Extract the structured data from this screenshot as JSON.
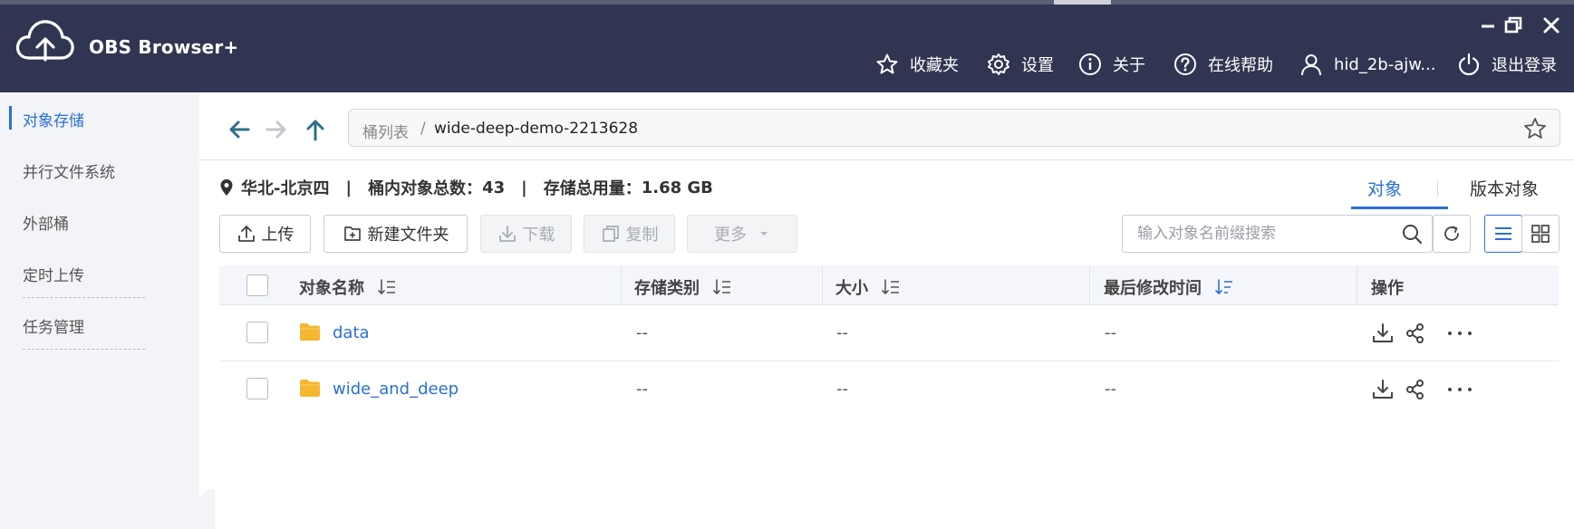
{
  "app": {
    "title": "OBS Browser+"
  },
  "window": {
    "minimize": "minimize",
    "maximize": "restore",
    "close": "close"
  },
  "topnav": [
    {
      "label": "收藏夹",
      "icon": "star-icon"
    },
    {
      "label": "设置",
      "icon": "gear-icon"
    },
    {
      "label": "关于",
      "icon": "info-icon"
    },
    {
      "label": "在线帮助",
      "icon": "help-icon"
    },
    {
      "label": "hid_2b-ajw...",
      "icon": "user-icon"
    },
    {
      "label": "退出登录",
      "icon": "power-icon"
    }
  ],
  "sidebar": {
    "items": [
      {
        "label": "对象存储",
        "active": true
      },
      {
        "label": "并行文件系统"
      },
      {
        "label": "外部桶"
      },
      {
        "label": "定时上传"
      },
      {
        "label": "任务管理"
      }
    ]
  },
  "path": {
    "root": "桶列表",
    "separator": "/",
    "current": "wide-deep-demo-2213628"
  },
  "info": {
    "region": "华北-北京四",
    "object_count_label": "桶内对象总数：",
    "object_count": "43",
    "storage_label": "存储总用量：",
    "storage": "1.68 GB",
    "separator": "|"
  },
  "tabs": {
    "objects": "对象",
    "versions": "版本对象"
  },
  "toolbar": {
    "upload": "上传",
    "new_folder": "新建文件夹",
    "download": "下载",
    "copy": "复制",
    "more": "更多"
  },
  "search": {
    "placeholder": "输入对象名前缀搜索"
  },
  "table": {
    "columns": {
      "name": "对象名称",
      "storage_class": "存储类别",
      "size": "大小",
      "modified": "最后修改时间",
      "actions": "操作"
    },
    "rows": [
      {
        "name": "data",
        "storage_class": "--",
        "size": "--",
        "modified": "--"
      },
      {
        "name": "wide_and_deep",
        "storage_class": "--",
        "size": "--",
        "modified": "--"
      }
    ]
  },
  "colors": {
    "titlebar": "#303651",
    "accent": "#2a6fd6",
    "folder": "#f5b731"
  }
}
